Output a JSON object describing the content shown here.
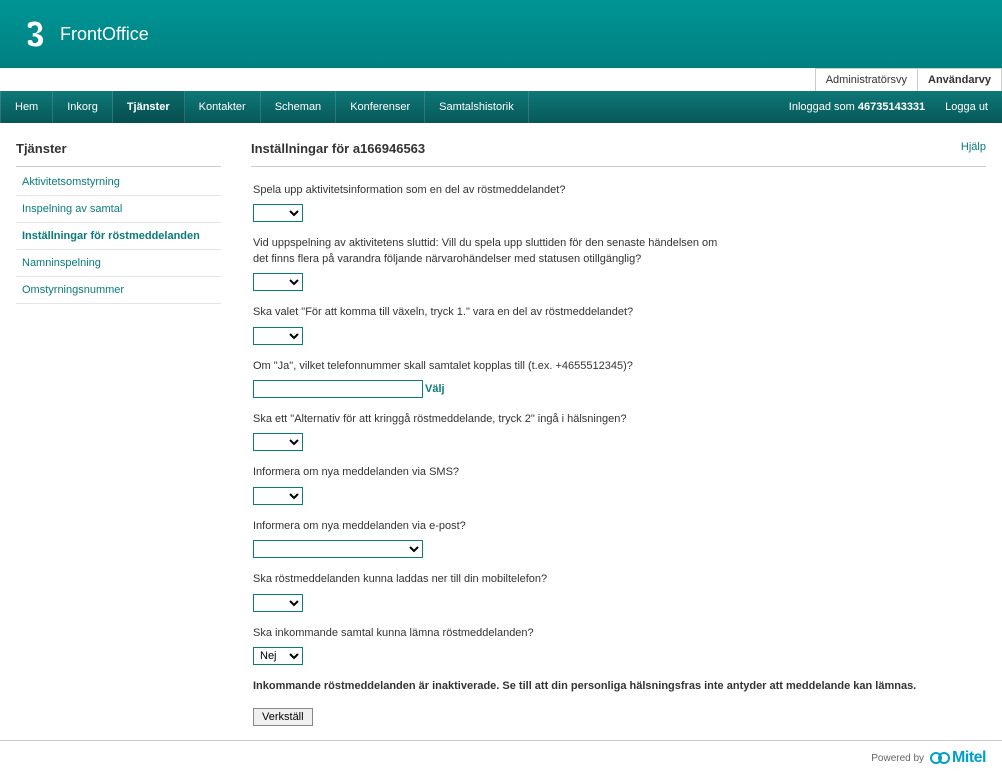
{
  "brand": "FrontOffice",
  "viewTabs": {
    "admin": "Administratörsvy",
    "user": "Användarvy"
  },
  "nav": {
    "items": [
      "Hem",
      "Inkorg",
      "Tjänster",
      "Kontakter",
      "Scheman",
      "Konferenser",
      "Samtalshistorik"
    ],
    "activeIndex": 2,
    "loggedInPrefix": "Inloggad som ",
    "loggedInUser": "46735143331",
    "logout": "Logga ut"
  },
  "sidebar": {
    "title": "Tjänster",
    "items": [
      "Aktivitetsomstyrning",
      "Inspelning av samtal",
      "Inställningar för röstmeddelanden",
      "Namninspelning",
      "Omstyrningsnummer"
    ],
    "activeIndex": 2
  },
  "main": {
    "title": "Inställningar för a166946563",
    "help": "Hjälp",
    "fields": [
      {
        "label": "Spela upp aktivitetsinformation som en del av röstmeddelandet?",
        "type": "select-small",
        "value": ""
      },
      {
        "label": "Vid uppspelning av aktivitetens sluttid: Vill du spela upp sluttiden för den senaste händelsen om det finns flera på varandra följande närvarohändelser med statusen otillgänglig?",
        "type": "select-small",
        "value": ""
      },
      {
        "label": "Ska valet \"För att komma till växeln, tryck 1.\" vara en del av röstmeddelandet?",
        "type": "select-small",
        "value": ""
      },
      {
        "label": "Om \"Ja\", vilket telefonnummer skall samtalet kopplas till (t.ex. +4655512345)?",
        "type": "input-pick",
        "value": "",
        "pick": "Välj"
      },
      {
        "label": "Ska ett \"Alternativ för att kringgå röstmeddelande, tryck 2\" ingå i hälsningen?",
        "type": "select-small",
        "value": ""
      },
      {
        "label": "Informera om nya meddelanden via SMS?",
        "type": "select-small",
        "value": ""
      },
      {
        "label": "Informera om nya meddelanden via e-post?",
        "type": "select-med",
        "value": ""
      },
      {
        "label": "Ska röstmeddelanden kunna laddas ner till din mobiltelefon?",
        "type": "select-small",
        "value": ""
      },
      {
        "label": "Ska inkommande samtal kunna lämna röstmeddelanden?",
        "type": "select-small",
        "value": "Nej"
      }
    ],
    "warning": "Inkommande röstmeddelanden är inaktiverade. Se till att din personliga hälsningsfras inte antyder att meddelande kan lämnas.",
    "apply": "Verkställ"
  },
  "footer": {
    "powered": "Powered by",
    "vendor": "Mitel"
  }
}
